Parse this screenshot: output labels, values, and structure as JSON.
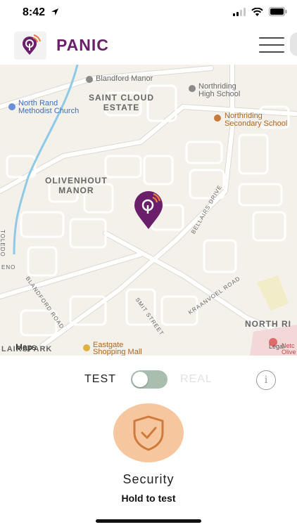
{
  "status_bar": {
    "time": "8:42"
  },
  "header": {
    "app_name": "PANIC"
  },
  "map": {
    "labels": {
      "blandford_manor": "Blandford Manor",
      "saint_cloud_estate": "SAINT CLOUD\nESTATE",
      "northriding_high": "Northriding\nHigh School",
      "north_rand_church": "North Rand\nMethodist Church",
      "northriding_secondary": "Northriding\nSecondary School",
      "olivenhout_manor": "OLIVENHOUT\nMANOR",
      "toledo": "TOLEDO",
      "bellairs_drive": "BELLAIRS DRIVE",
      "blandford_road": "BLANDFORD ROAD",
      "smit_street": "SMIT STREET",
      "kraanvoel_road": "KRAANVOEL ROAD",
      "north_rio": "NORTH RI",
      "eastgate_mall": "Eastgate\nShopping Mall",
      "netcare": "Netc\nOlive",
      "legal": "Legal",
      "maps_brand": "Maps",
      "left_edge_road": "ENO",
      "lairspark": "LAIRSPARK"
    }
  },
  "controls": {
    "test_label": "TEST",
    "real_label": "REAL",
    "info_glyph": "i",
    "mode_is_real": false,
    "button_label": "Security",
    "hint": "Hold to test"
  },
  "colors": {
    "brand": "#6b1f6b",
    "brand_accent": "#e8793a",
    "button_bg": "#f6c79f",
    "button_icon": "#d07a3a",
    "toggle_bg": "#a9beae"
  },
  "icons": {
    "location_arrow": "location-arrow-icon",
    "signal": "signal-icon",
    "wifi": "wifi-icon",
    "battery": "battery-icon",
    "logo": "panic-logo-icon",
    "menu": "hamburger-menu-icon",
    "pin": "map-pin-icon",
    "info": "info-icon",
    "shield": "shield-check-icon"
  }
}
